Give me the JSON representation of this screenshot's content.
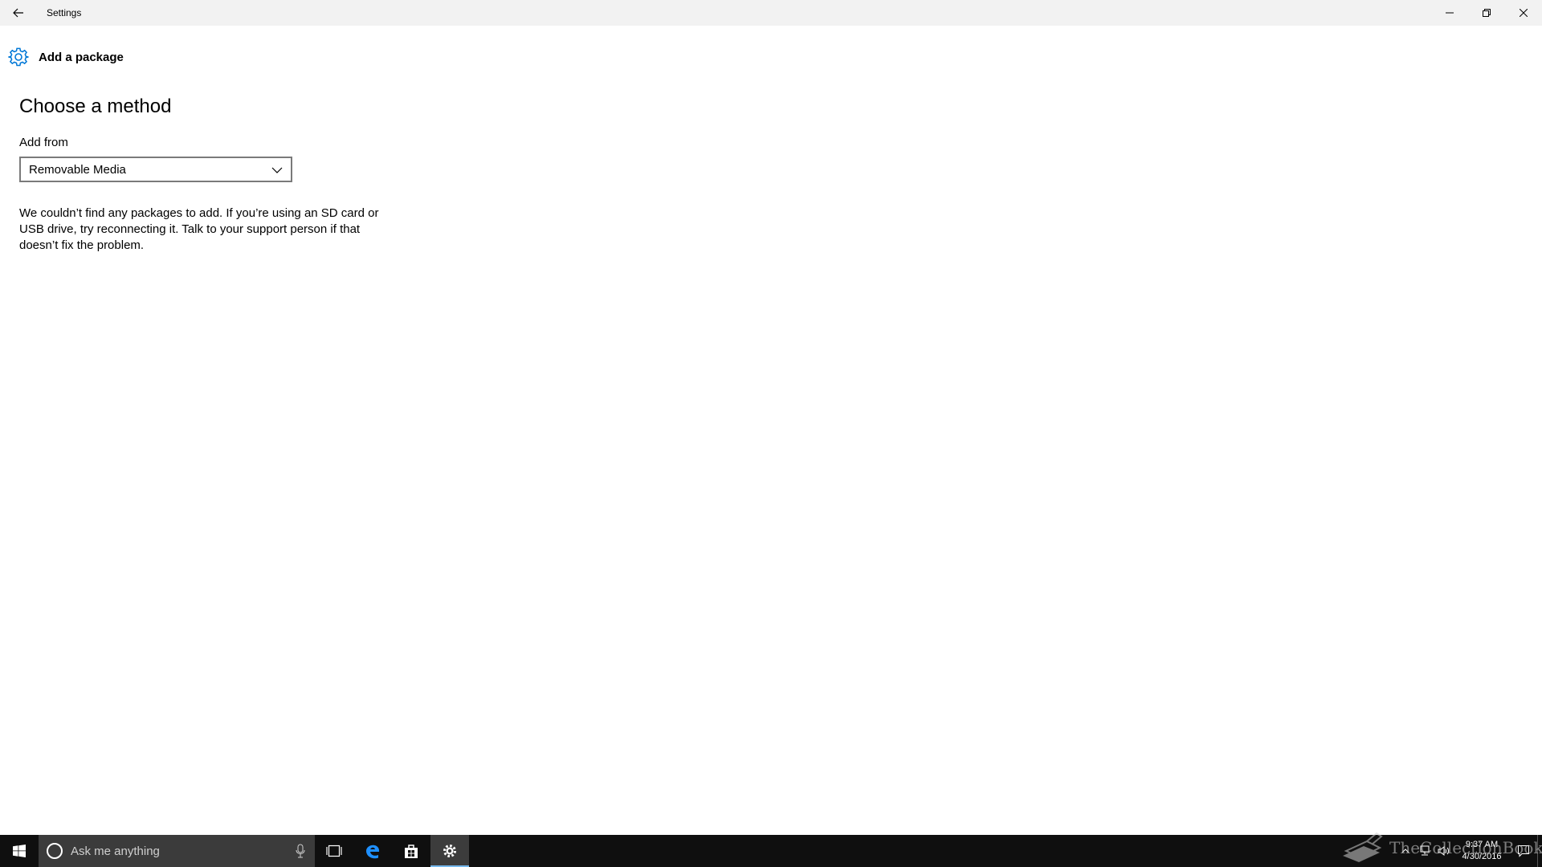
{
  "window": {
    "title": "Settings",
    "back_icon": "back-arrow-icon",
    "controls": [
      "minimize-icon",
      "restore-icon",
      "close-icon"
    ]
  },
  "page": {
    "header_icon": "gear-icon",
    "header_title": "Add a package",
    "heading": "Choose a method",
    "add_from_label": "Add from",
    "add_from_value": "Removable Media",
    "message": "We couldn’t find any packages to add. If you’re using an SD card or USB drive, try reconnecting it. Talk to your support person if that doesn’t fix the problem."
  },
  "taskbar": {
    "search_placeholder": "Ask me anything",
    "pinned": [
      "task-view-icon",
      "edge-icon",
      "store-icon",
      "settings-icon"
    ],
    "active_app": "settings-icon",
    "watermark": "TheCollectionBook",
    "clock_time": "9:37 AM",
    "clock_date": "4/30/2016"
  },
  "colors": {
    "titlebar_bg": "#f2f2f2",
    "accent": "#0078d7",
    "taskbar_bg": "#0f0f0f",
    "search_bg": "#3b3b3b",
    "active_indicator": "#76b9ed"
  }
}
